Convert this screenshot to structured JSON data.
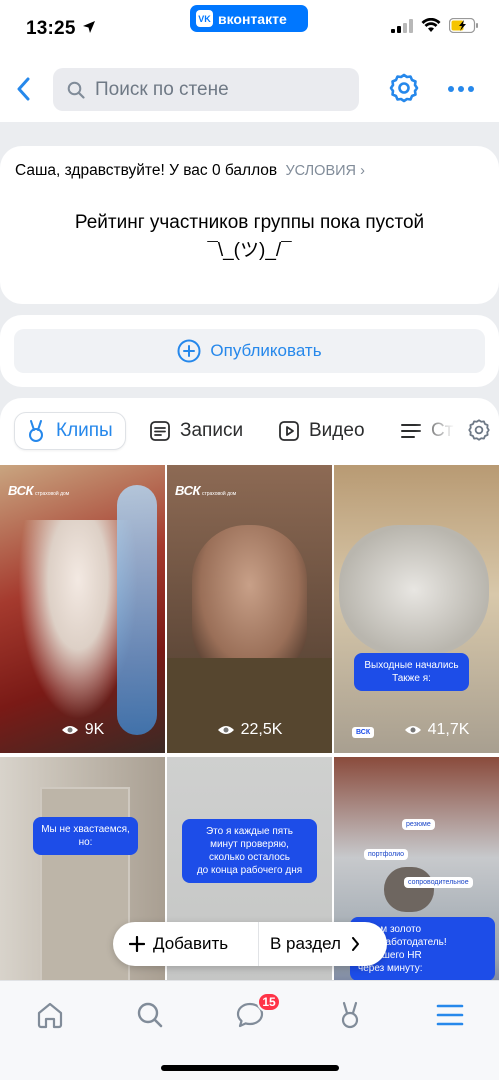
{
  "status_bar": {
    "time": "13:25",
    "app_badge": "вконтакте"
  },
  "header": {
    "search_placeholder": "Поиск по стене"
  },
  "rating": {
    "greeting": "Саша, здравствуйте! У вас 0 баллов",
    "conditions_link": "УСЛОВИЯ",
    "empty_text": "Рейтинг участников группы пока пустой",
    "shrug": "¯\\_(ツ)_/¯"
  },
  "publish": {
    "label": "Опубликовать"
  },
  "tabs": [
    {
      "label": "Клипы",
      "icon": "clips-icon",
      "active": true
    },
    {
      "label": "Записи",
      "icon": "posts-icon",
      "active": false
    },
    {
      "label": "Видео",
      "icon": "video-icon",
      "active": false
    },
    {
      "label": "Ст",
      "icon": "articles-icon",
      "active": false
    }
  ],
  "clips": [
    {
      "views": "9K",
      "brand": "ВСК"
    },
    {
      "views": "22,5K",
      "brand": "ВСК"
    },
    {
      "views": "41,7K",
      "caption": "Выходные начались\nТакже я:",
      "brand": "ВСК"
    },
    {
      "caption": "Мы не хвастаемся,\nно:"
    },
    {
      "caption": "Это я каждые пять\nминут проверяю,\nсколько осталось\nдо конца рабочего дня"
    },
    {
      "labels": [
        "резюме",
        "портфолио",
        "сопроводительное"
      ],
      "caption": "берем золото\nший работодатель!\nта нашего HR\nчерез минуту:"
    }
  ],
  "floating": {
    "add_label": "Добавить",
    "section_label": "В раздел"
  },
  "bottom_nav": {
    "messages_badge": "15"
  },
  "colors": {
    "accent": "#2688eb",
    "vk_blue": "#0077ff",
    "badge_red": "#ff3347",
    "clip_blue": "#1d4de8"
  }
}
